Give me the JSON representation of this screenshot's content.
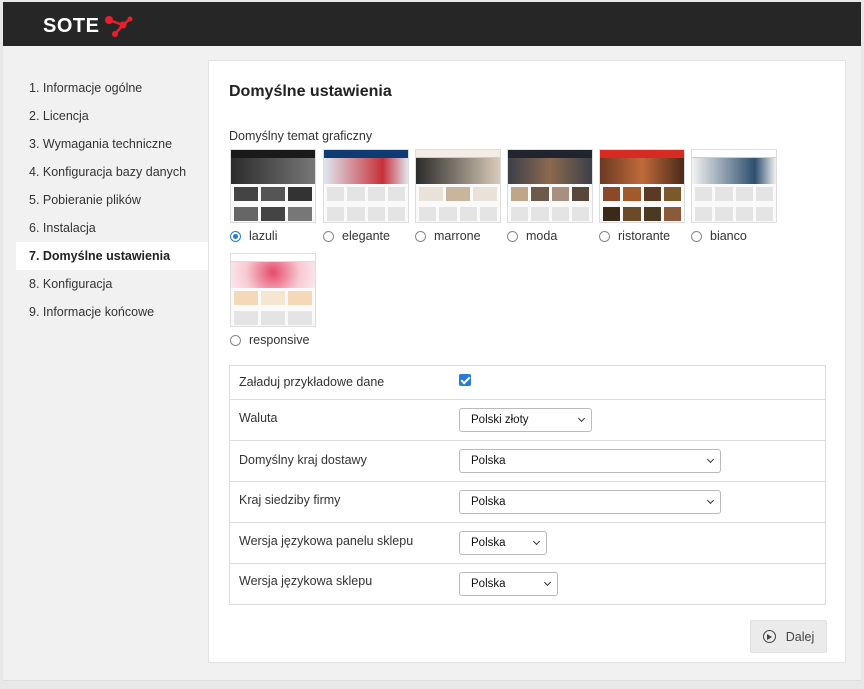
{
  "header": {
    "logo_text": "SOTE",
    "logo_icon": "molecule-icon",
    "brand_color": "#e8202e"
  },
  "sidebar": {
    "items": [
      {
        "label": "1. Informacje ogólne"
      },
      {
        "label": "2. Licencja"
      },
      {
        "label": "3. Wymagania techniczne"
      },
      {
        "label": "4. Konfiguracja bazy danych"
      },
      {
        "label": "5. Pobieranie plików"
      },
      {
        "label": "6. Instalacja"
      },
      {
        "label": "7. Domyślne ustawienia",
        "active": true
      },
      {
        "label": "8. Konfiguracja"
      },
      {
        "label": "9. Informacje końcowe"
      }
    ]
  },
  "main": {
    "title": "Domyślne ustawienia",
    "theme_section_label": "Domyślny temat graficzny",
    "themes": [
      {
        "name": "lazuli",
        "selected": true,
        "colors": [
          "#1a1a1a",
          "#3a3a3a"
        ]
      },
      {
        "name": "elegante",
        "selected": false,
        "colors": [
          "#0f3b73",
          "#e9eef5"
        ]
      },
      {
        "name": "marrone",
        "selected": false,
        "colors": [
          "#2b2b2b",
          "#f3ede5"
        ]
      },
      {
        "name": "moda",
        "selected": false,
        "colors": [
          "#20242c",
          "#8c6a4f"
        ]
      },
      {
        "name": "ristorante",
        "selected": false,
        "colors": [
          "#d62a22",
          "#6b3a24"
        ]
      },
      {
        "name": "bianco",
        "selected": false,
        "colors": [
          "#ffffff",
          "#2e4f6e"
        ]
      },
      {
        "name": "responsive",
        "selected": false,
        "colors": [
          "#f7c9d3",
          "#e54b6a"
        ]
      }
    ],
    "settings": {
      "sample_data": {
        "label": "Załaduj przykładowe dane",
        "checked": true
      },
      "currency": {
        "label": "Waluta",
        "value": "Polski złoty"
      },
      "shipping_country": {
        "label": "Domyślny kraj dostawy",
        "value": "Polska"
      },
      "company_country": {
        "label": "Kraj siedziby firmy",
        "value": "Polska"
      },
      "panel_language": {
        "label": "Wersja językowa panelu sklepu",
        "value": "Polska"
      },
      "shop_language": {
        "label": "Wersja językowa sklepu",
        "value": "Polska"
      }
    },
    "next_button": {
      "label": "Dalej",
      "icon": "play-circle-icon"
    }
  }
}
